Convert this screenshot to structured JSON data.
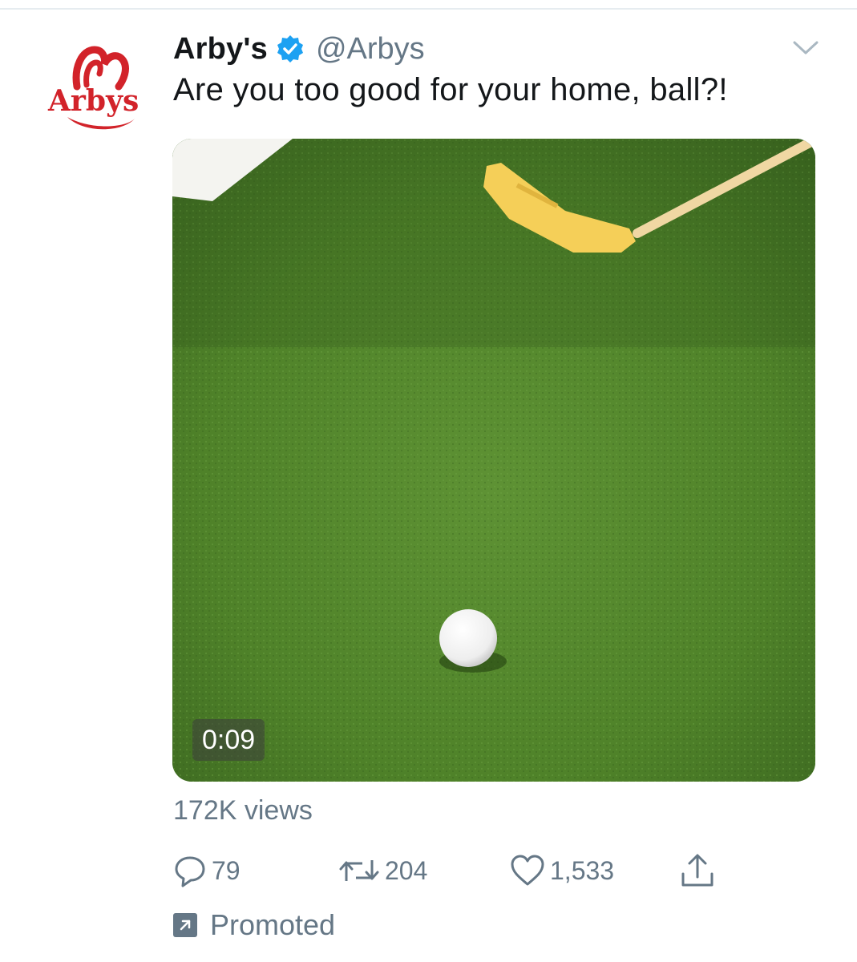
{
  "tweet": {
    "display_name": "Arby's",
    "handle": "@Arbys",
    "verified": true,
    "avatar_logo_text": "Arby's",
    "text": "Are you too good for your home, ball?!",
    "media": {
      "type": "video",
      "duration": "0:09"
    },
    "views": "172K views",
    "actions": {
      "reply": {
        "icon": "reply-icon",
        "count": "79"
      },
      "retweet": {
        "icon": "retweet-icon",
        "count": "204"
      },
      "like": {
        "icon": "heart-icon",
        "count": "1,533"
      },
      "share": {
        "icon": "share-icon"
      }
    },
    "promoted_label": "Promoted"
  },
  "colors": {
    "brand_red": "#d2232a",
    "verified_blue": "#1da1f2",
    "secondary_text": "#657786",
    "primary_text": "#14171a"
  }
}
